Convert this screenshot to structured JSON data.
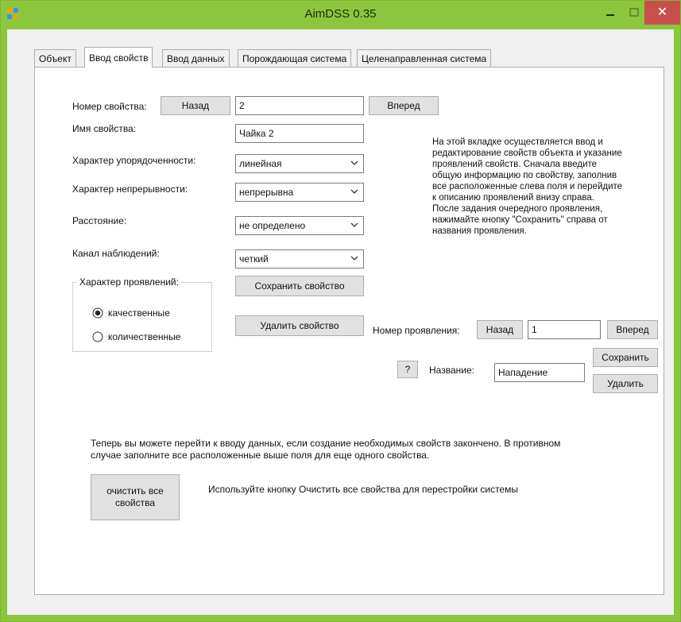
{
  "window": {
    "title": "AimDSS 0.35",
    "close_glyph": "✕"
  },
  "tabs": [
    {
      "label": "Объект"
    },
    {
      "label": "Ввод свойств"
    },
    {
      "label": "Ввод данных"
    },
    {
      "label": "Порождающая система"
    },
    {
      "label": "Целенаправленная система"
    }
  ],
  "property": {
    "number_label": "Номер свойства:",
    "back_label": "Назад",
    "number_value": "2",
    "forward_label": "Вперед",
    "name_label": "Имя свойства:",
    "name_value": "Чайка 2",
    "order_label": "Характер упорядоченности:",
    "order_value": "линейная",
    "continuity_label": "Характер непрерывности:",
    "continuity_value": "непрерывна",
    "distance_label": "Расстояние:",
    "distance_value": "не определено",
    "channel_label": "Канал наблюдений:",
    "channel_value": "четкий",
    "save_label": "Сохранить свойство",
    "delete_label": "Удалить свойство"
  },
  "manifest_group": {
    "legend": "Характер проявлений:",
    "qualitative": "качественные",
    "quantitative": "количественные",
    "selected": "qualitative"
  },
  "info_text": "На этой вкладке осуществляется ввод и редактирование свойств объекта и указание проявлений свойств. Сначала введите общую информацию по свойству, заполнив все расположенные слева поля и перейдите к описанию проявлений внизу справа. После задания очередного проявления, нажимайте кнопку \"Сохранить\" справа от названия проявления.",
  "manifestation": {
    "number_label": "Номер проявления:",
    "back_label": "Назад",
    "number_value": "1",
    "forward_label": "Вперед",
    "help_label": "?",
    "name_label": "Название:",
    "name_value": "Нападение",
    "save_label": "Сохранить",
    "delete_label": "Удалить"
  },
  "footer": {
    "hint": "Теперь вы можете перейти к вводу данных, если создание необходимых свойств закончено. В противном случае заполните все расположенные выше поля для еще одного свойства.",
    "clear_label": "очистить все свойства",
    "clear_hint": "Используйте кнопку Очистить все свойства для перестройки системы"
  },
  "colors": {
    "titlebar": "#8cc63f",
    "close": "#c7504b",
    "panel": "#ffffff",
    "form": "#f0f0f0"
  }
}
